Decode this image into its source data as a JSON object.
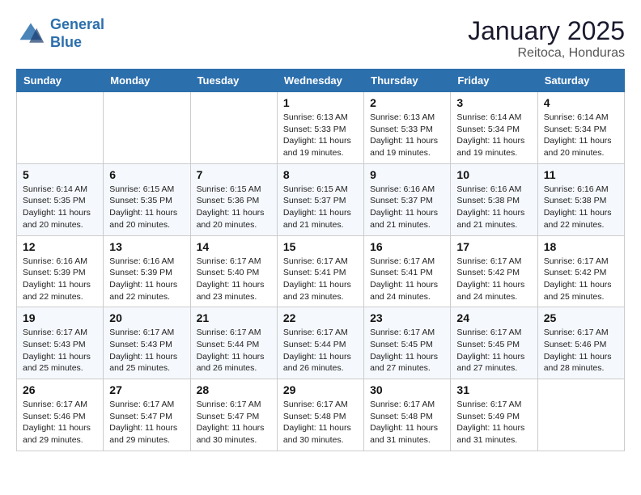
{
  "header": {
    "logo_line1": "General",
    "logo_line2": "Blue",
    "month": "January 2025",
    "location": "Reitoca, Honduras"
  },
  "weekdays": [
    "Sunday",
    "Monday",
    "Tuesday",
    "Wednesday",
    "Thursday",
    "Friday",
    "Saturday"
  ],
  "weeks": [
    [
      {
        "day": "",
        "info": ""
      },
      {
        "day": "",
        "info": ""
      },
      {
        "day": "",
        "info": ""
      },
      {
        "day": "1",
        "info": "Sunrise: 6:13 AM\nSunset: 5:33 PM\nDaylight: 11 hours and 19 minutes."
      },
      {
        "day": "2",
        "info": "Sunrise: 6:13 AM\nSunset: 5:33 PM\nDaylight: 11 hours and 19 minutes."
      },
      {
        "day": "3",
        "info": "Sunrise: 6:14 AM\nSunset: 5:34 PM\nDaylight: 11 hours and 19 minutes."
      },
      {
        "day": "4",
        "info": "Sunrise: 6:14 AM\nSunset: 5:34 PM\nDaylight: 11 hours and 20 minutes."
      }
    ],
    [
      {
        "day": "5",
        "info": "Sunrise: 6:14 AM\nSunset: 5:35 PM\nDaylight: 11 hours and 20 minutes."
      },
      {
        "day": "6",
        "info": "Sunrise: 6:15 AM\nSunset: 5:35 PM\nDaylight: 11 hours and 20 minutes."
      },
      {
        "day": "7",
        "info": "Sunrise: 6:15 AM\nSunset: 5:36 PM\nDaylight: 11 hours and 20 minutes."
      },
      {
        "day": "8",
        "info": "Sunrise: 6:15 AM\nSunset: 5:37 PM\nDaylight: 11 hours and 21 minutes."
      },
      {
        "day": "9",
        "info": "Sunrise: 6:16 AM\nSunset: 5:37 PM\nDaylight: 11 hours and 21 minutes."
      },
      {
        "day": "10",
        "info": "Sunrise: 6:16 AM\nSunset: 5:38 PM\nDaylight: 11 hours and 21 minutes."
      },
      {
        "day": "11",
        "info": "Sunrise: 6:16 AM\nSunset: 5:38 PM\nDaylight: 11 hours and 22 minutes."
      }
    ],
    [
      {
        "day": "12",
        "info": "Sunrise: 6:16 AM\nSunset: 5:39 PM\nDaylight: 11 hours and 22 minutes."
      },
      {
        "day": "13",
        "info": "Sunrise: 6:16 AM\nSunset: 5:39 PM\nDaylight: 11 hours and 22 minutes."
      },
      {
        "day": "14",
        "info": "Sunrise: 6:17 AM\nSunset: 5:40 PM\nDaylight: 11 hours and 23 minutes."
      },
      {
        "day": "15",
        "info": "Sunrise: 6:17 AM\nSunset: 5:41 PM\nDaylight: 11 hours and 23 minutes."
      },
      {
        "day": "16",
        "info": "Sunrise: 6:17 AM\nSunset: 5:41 PM\nDaylight: 11 hours and 24 minutes."
      },
      {
        "day": "17",
        "info": "Sunrise: 6:17 AM\nSunset: 5:42 PM\nDaylight: 11 hours and 24 minutes."
      },
      {
        "day": "18",
        "info": "Sunrise: 6:17 AM\nSunset: 5:42 PM\nDaylight: 11 hours and 25 minutes."
      }
    ],
    [
      {
        "day": "19",
        "info": "Sunrise: 6:17 AM\nSunset: 5:43 PM\nDaylight: 11 hours and 25 minutes."
      },
      {
        "day": "20",
        "info": "Sunrise: 6:17 AM\nSunset: 5:43 PM\nDaylight: 11 hours and 25 minutes."
      },
      {
        "day": "21",
        "info": "Sunrise: 6:17 AM\nSunset: 5:44 PM\nDaylight: 11 hours and 26 minutes."
      },
      {
        "day": "22",
        "info": "Sunrise: 6:17 AM\nSunset: 5:44 PM\nDaylight: 11 hours and 26 minutes."
      },
      {
        "day": "23",
        "info": "Sunrise: 6:17 AM\nSunset: 5:45 PM\nDaylight: 11 hours and 27 minutes."
      },
      {
        "day": "24",
        "info": "Sunrise: 6:17 AM\nSunset: 5:45 PM\nDaylight: 11 hours and 27 minutes."
      },
      {
        "day": "25",
        "info": "Sunrise: 6:17 AM\nSunset: 5:46 PM\nDaylight: 11 hours and 28 minutes."
      }
    ],
    [
      {
        "day": "26",
        "info": "Sunrise: 6:17 AM\nSunset: 5:46 PM\nDaylight: 11 hours and 29 minutes."
      },
      {
        "day": "27",
        "info": "Sunrise: 6:17 AM\nSunset: 5:47 PM\nDaylight: 11 hours and 29 minutes."
      },
      {
        "day": "28",
        "info": "Sunrise: 6:17 AM\nSunset: 5:47 PM\nDaylight: 11 hours and 30 minutes."
      },
      {
        "day": "29",
        "info": "Sunrise: 6:17 AM\nSunset: 5:48 PM\nDaylight: 11 hours and 30 minutes."
      },
      {
        "day": "30",
        "info": "Sunrise: 6:17 AM\nSunset: 5:48 PM\nDaylight: 11 hours and 31 minutes."
      },
      {
        "day": "31",
        "info": "Sunrise: 6:17 AM\nSunset: 5:49 PM\nDaylight: 11 hours and 31 minutes."
      },
      {
        "day": "",
        "info": ""
      }
    ]
  ]
}
